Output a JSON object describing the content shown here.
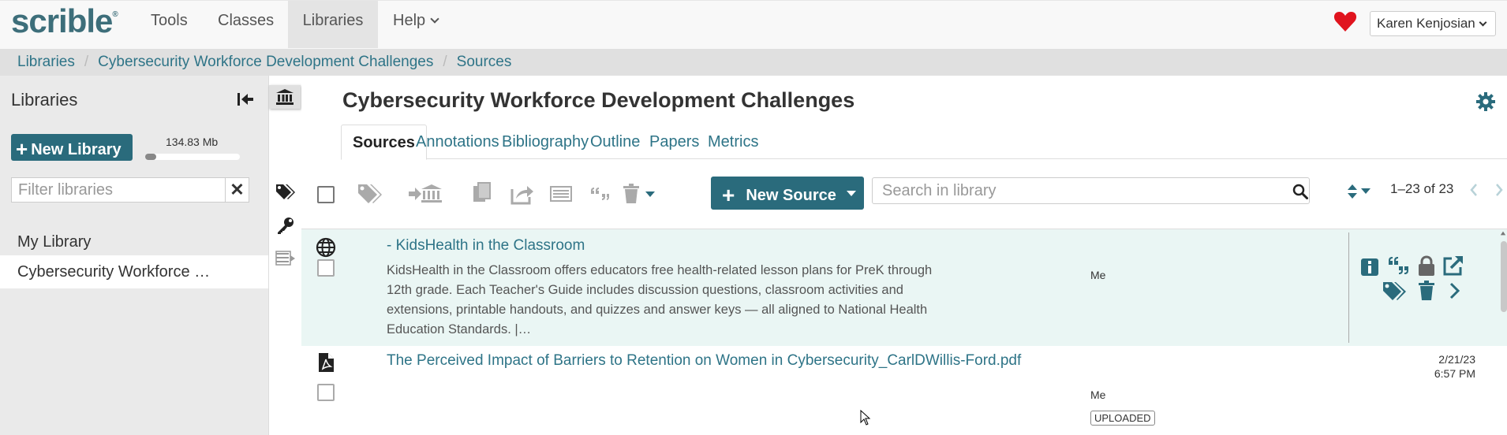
{
  "nav": {
    "logo": "scrible",
    "items": [
      "Tools",
      "Classes",
      "Libraries",
      "Help"
    ],
    "user": "Karen Kenjosian",
    "accent_color": "#2a6b7c",
    "heart_color": "#e0141e"
  },
  "breadcrumb": [
    "Libraries",
    "Cybersecurity Workforce Development Challenges",
    "Sources"
  ],
  "sidebar": {
    "title": "Libraries",
    "new_library_label": "New Library",
    "storage_label": "134.83 Mb",
    "storage_fraction": 0.08,
    "filter_placeholder": "Filter libraries",
    "libraries": [
      {
        "label": "My Library",
        "selected": false
      },
      {
        "label": "Cybersecurity Workforce …",
        "selected": true
      }
    ]
  },
  "main": {
    "title": "Cybersecurity Workforce Development Challenges",
    "tabs": [
      {
        "label": "Sources",
        "active": true
      },
      {
        "label": "Annotations"
      },
      {
        "label": "Bibliography"
      },
      {
        "label": "Outline"
      },
      {
        "label": "Papers"
      },
      {
        "label": "Metrics"
      }
    ],
    "toolbar": {
      "new_source_label": "New Source",
      "search_placeholder": "Search in library",
      "pager": "1–23 of 23"
    },
    "sources": [
      {
        "type_icon": "globe-icon",
        "title": "- KidsHealth in the Classroom",
        "description": "KidsHealth in the Classroom offers educators free health-related lesson plans for PreK through 12th grade. Each Teacher's Guide includes discussion questions, classroom activities and extensions, printable handouts, and quizzes and answer keys — all aligned to National Health Education Standards. |…",
        "owner": "Me"
      },
      {
        "type_icon": "pdf-icon",
        "title": "The Perceived Impact of Barriers to Retention on Women in Cybersecurity_CarlDWillis-Ford.pdf",
        "owner": "Me",
        "badge": "UPLOADED",
        "date": "2/21/23",
        "time": "6:57 PM"
      }
    ]
  }
}
